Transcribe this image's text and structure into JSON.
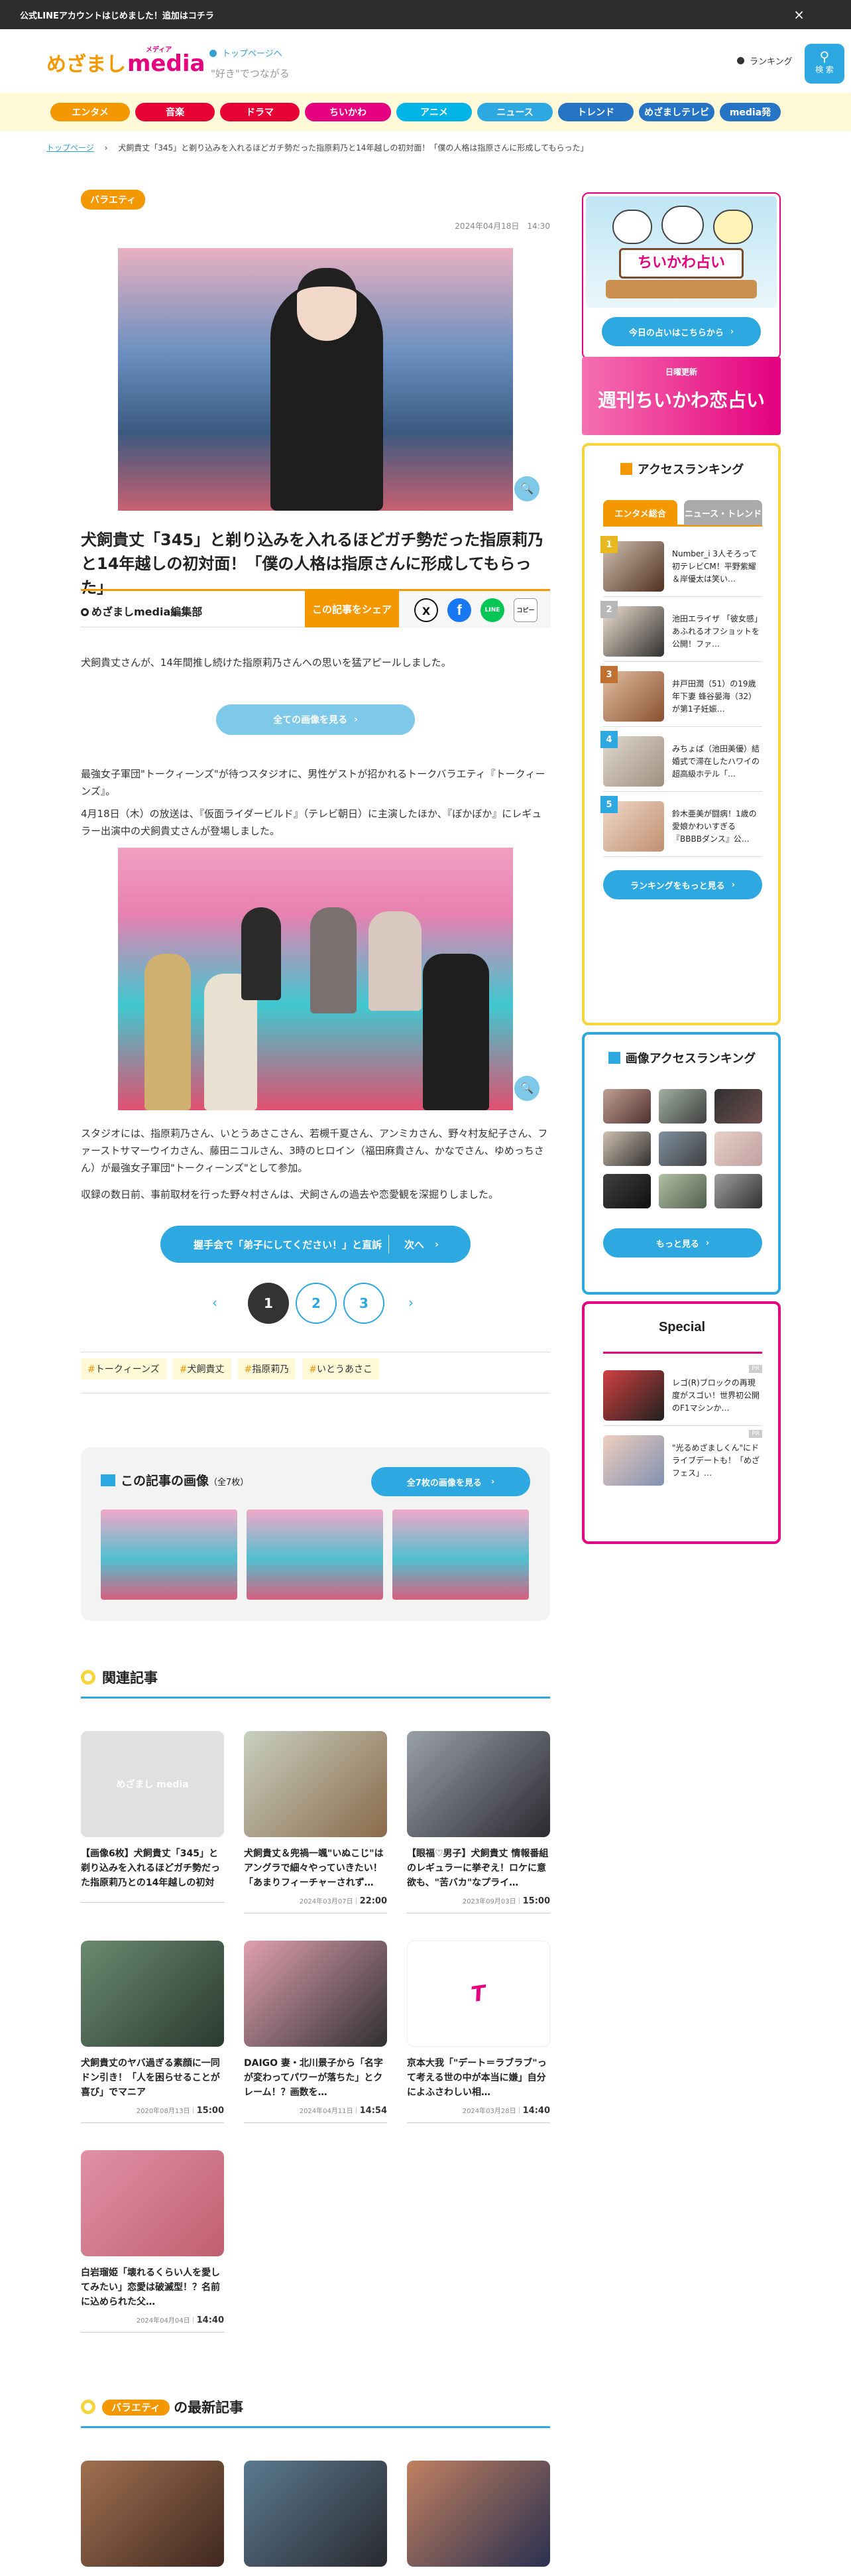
{
  "topbar": {
    "text": "公式LINEアカウントはじめました！追加はコチラ",
    "close": "×"
  },
  "header": {
    "logo_a": "めざまし",
    "logo_b": "media",
    "logo_c": "メディア",
    "to_top": "トップページへ",
    "slogan": "\"好き\"でつながる",
    "ranking_link": "ランキング",
    "search_label": "検 索"
  },
  "nav": [
    {
      "label": "エンタメ",
      "color": "#f39800"
    },
    {
      "label": "音楽",
      "color": "#e60033"
    },
    {
      "label": "ドラマ",
      "color": "#e60033"
    },
    {
      "label": "ちいかわ",
      "color": "#e4007f"
    },
    {
      "label": "アニメ",
      "color": "#00b4e6"
    },
    {
      "label": "ニュース",
      "color": "#2da8e0"
    },
    {
      "label": "トレンド",
      "color": "#2575c4"
    },
    {
      "label": "めざましテレビ",
      "color": "#2575c4"
    },
    {
      "label": "media発",
      "color": "#2575c4"
    }
  ],
  "breadcrumb": {
    "home": "トップページ",
    "sep": "›",
    "current": "犬飼貴丈「345」と剃り込みを入れるほどガチ勢だった指原莉乃と14年越しの初対面！「僕の人格は指原さんに形成してもらった」"
  },
  "article": {
    "category": "バラエティ",
    "date": "2024年04月18日",
    "time": "14:30",
    "title": "犬飼貴丈「345」と剃り込みを入れるほどガチ勢だった指原莉乃と14年越しの初対面！「僕の人格は指原さんに形成してもらった」",
    "author": "めざましmedia編集部",
    "share_label": "この記事をシェア",
    "share_icons": [
      "X",
      "f",
      "LINE",
      "コピー"
    ],
    "p1": "犬飼貴丈さんが、14年間推し続けた指原莉乃さんへの思いを猛アピールしました。",
    "all_images_btn": "全ての画像を見る",
    "p2": "最強女子軍団\"トークィーンズ\"が待つスタジオに、男性ゲストが招かれるトークバラエティ『トークィーンズ』。",
    "p3": "4月18日（木）の放送は、『仮面ライダービルド』（テレビ朝日）に主演したほか、『ぼかぼか』にレギュラー出演中の犬飼貴丈さんが登場しました。",
    "p4": "スタジオには、指原莉乃さん、いとうあさこさん、若槻千夏さん、アンミカさん、野々村友紀子さん、ファーストサマーウイカさん、藤田ニコルさん、3時のヒロイン（福田麻貴さん、かなでさん、ゆめっちさん）が最強女子軍団\"トークィーンズ\"として参加。",
    "p5": "収録の数日前、事前取材を行った野々村さんは、犬飼さんの過去や恋愛観を深掘りしました。",
    "next_text": "握手会で「弟子にしてください！」と直訴",
    "next_label": "次へ",
    "pages": [
      "1",
      "2",
      "3"
    ],
    "tags": [
      "トークィーンズ",
      "犬飼貴丈",
      "指原莉乃",
      "いとうあさこ"
    ]
  },
  "gallery": {
    "title": "この記事の画像",
    "count": "（全7枚）",
    "button": "全7枚の画像を見る"
  },
  "related": {
    "title": "関連記事",
    "items": [
      {
        "title": "【画像6枚】犬飼貴丈「345」と剃り込みを入れるほどガチ勢だった指原莉乃との14年越しの初対面…",
        "date": "",
        "time": "",
        "placeholder": "めざまし media"
      },
      {
        "title": "犬飼貴丈＆兜禍一颯\"いぬこじ\"はアングラで細々やっていきたい！「あまりフィーチャーされず…",
        "date": "2024年03月07日",
        "time": "22:00"
      },
      {
        "title": "【眼福♡男子】犬飼貴丈 情報番組のレギュラーに挙ぞえ！ロケに意欲も、\"苦バカ\"なプライ…",
        "date": "2023年09月03日",
        "time": "15:00"
      },
      {
        "title": "犬飼貴丈のヤバ過ぎる素顔に一同ドン引き！「人を困らせることが喜び」でマニア",
        "date": "2020年08月13日",
        "time": "15:00"
      },
      {
        "title": "DAIGO 妻・北川景子から「名字が変わってパワーが落ちた」とクレーム！？画数を…",
        "date": "2024年04月11日",
        "time": "14:54"
      },
      {
        "title": "京本大我「\"デート＝ラブラブ\"って考える世の中が本当に嫌」自分によふさわしい相…",
        "date": "2024年03月28日",
        "time": "14:40"
      },
      {
        "title": "白岩瑠姫「壊れるくらい人を愛してみたい」恋愛は破滅型！？名前に込められた父…",
        "date": "2024年04月04日",
        "time": "14:40"
      }
    ]
  },
  "latest": {
    "category": "バラエティ",
    "title": "の最新記事"
  },
  "sidebar": {
    "fortune_button": "今日の占いはこちらから",
    "fortune_banner_top": "ちいかわ占い",
    "weekly_banner_small": "日曜更新",
    "weekly_banner": "週刊ちいかわ恋占い",
    "ranking_title": "アクセスランキング",
    "ranking_tabs": [
      "エンタメ総合",
      "ニュース・トレンド"
    ],
    "ranking_items": [
      {
        "num": "1",
        "text": "Number_i 3人そろって初テレビCM！平野紫耀＆岸優太は笑い…"
      },
      {
        "num": "2",
        "text": "池田エライザ 「彼女感」あふれるオフショットを公開！ファ…"
      },
      {
        "num": "3",
        "text": "井戸田潤（51）の19歳年下妻 蜂谷晏海（32）が第1子妊娠…"
      },
      {
        "num": "4",
        "text": "みちょぱ（池田美優）結婚式で滞在したハワイの超高級ホテル「…"
      },
      {
        "num": "5",
        "text": "鈴木亜美が闘病！1歳の愛娘かわいすぎる『BBBBダンス』公…"
      }
    ],
    "ranking_more": "ランキングをもっと見る",
    "img_rank_title": "画像アクセスランキング",
    "img_rank_more": "もっと見る",
    "special_title": "Special",
    "special_items": [
      {
        "text": "レゴ(R)ブロックの再現度がスゴい！世界初公開のF1マシンか…",
        "badge": "PR"
      },
      {
        "text": "\"光るめざましくん\"にドライブデートも！「めざフェス」…",
        "badge": "PR"
      }
    ]
  }
}
